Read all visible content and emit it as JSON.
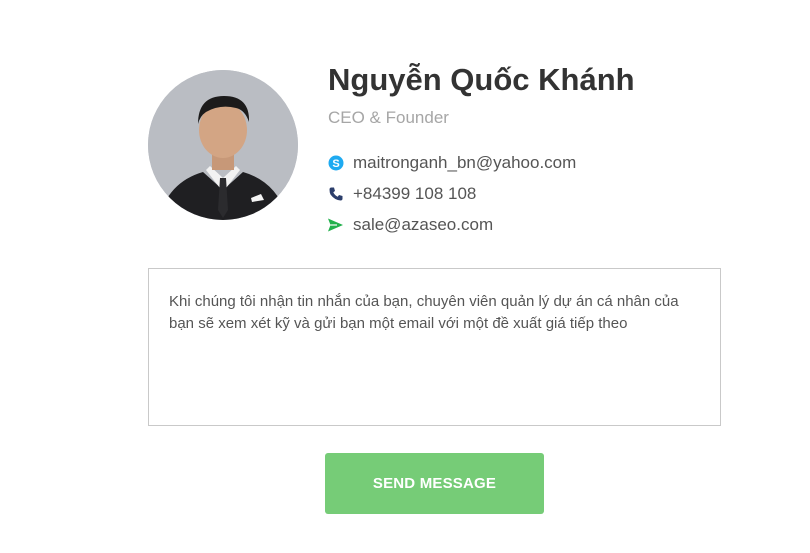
{
  "profile": {
    "name": "Nguyễn Quốc Khánh",
    "role": "CEO & Founder",
    "avatar_icon": "person-photo"
  },
  "contacts": {
    "skype": {
      "icon": "skype-icon",
      "value": "maitronganh_bn@yahoo.com",
      "color": "#1eaaf1"
    },
    "phone": {
      "icon": "phone-icon",
      "value": "+84399 108 108",
      "color": "#2c3e6b"
    },
    "email": {
      "icon": "send-icon",
      "value": "sale@azaseo.com",
      "color": "#22b14c"
    }
  },
  "message": {
    "text": "Khi chúng tôi nhận tin nhắn của bạn, chuyên viên quản lý dự án cá nhân của bạn sẽ xem xét kỹ và gửi bạn một email với một đề xuất giá tiếp theo"
  },
  "actions": {
    "send_label": "SEND MESSAGE",
    "send_color": "#76cc77"
  }
}
